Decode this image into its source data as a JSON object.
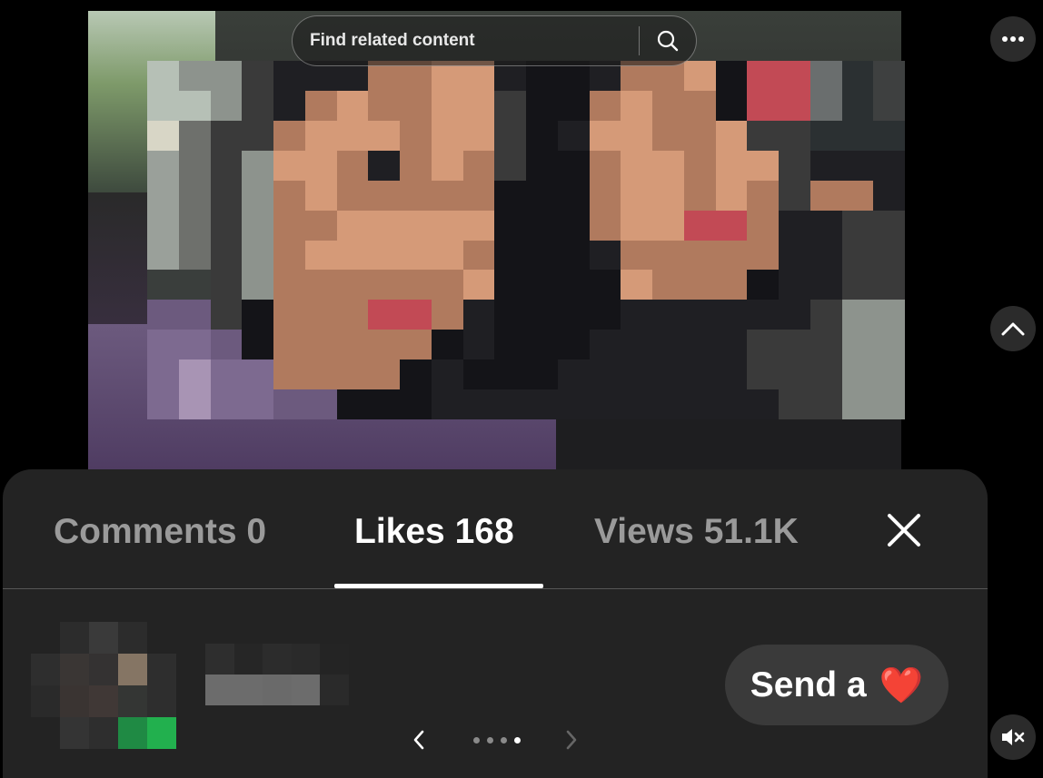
{
  "search": {
    "placeholder": "Find related content"
  },
  "tabs": [
    {
      "label": "Comments 0",
      "active": false
    },
    {
      "label": "Likes 168",
      "active": true
    },
    {
      "label": "Views 51.1K",
      "active": false
    }
  ],
  "send_button": {
    "label": "Send a",
    "emoji": "❤️"
  },
  "pager": {
    "total": 4,
    "current": 4
  },
  "icons": {
    "search": "search-icon",
    "more": "more-icon",
    "scroll_up": "chevron-up-icon",
    "close": "close-icon",
    "prev": "chevron-left-icon",
    "next": "chevron-right-icon",
    "mute": "mute-icon"
  },
  "colors": {
    "background": "#000000",
    "sheet": "#232323",
    "tab_inactive": "#9a9a9a",
    "tab_active": "#ffffff",
    "button": "#3a3a3a"
  }
}
